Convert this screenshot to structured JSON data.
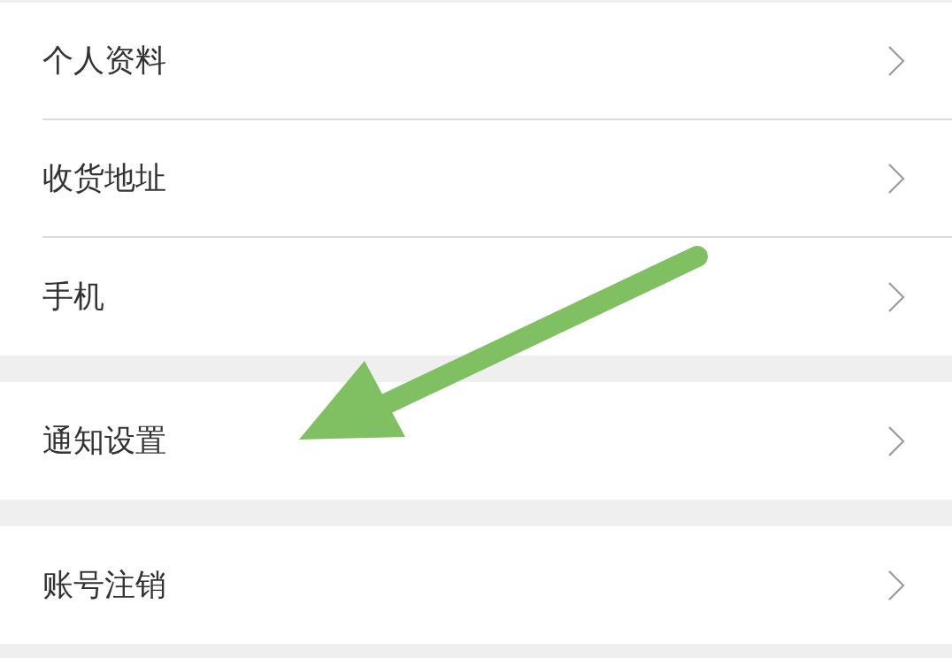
{
  "groups": [
    {
      "items": [
        {
          "label": "个人资料"
        },
        {
          "label": "收货地址"
        },
        {
          "label": "手机"
        }
      ]
    },
    {
      "items": [
        {
          "label": "通知设置"
        }
      ]
    },
    {
      "items": [
        {
          "label": "账号注销"
        }
      ]
    }
  ]
}
